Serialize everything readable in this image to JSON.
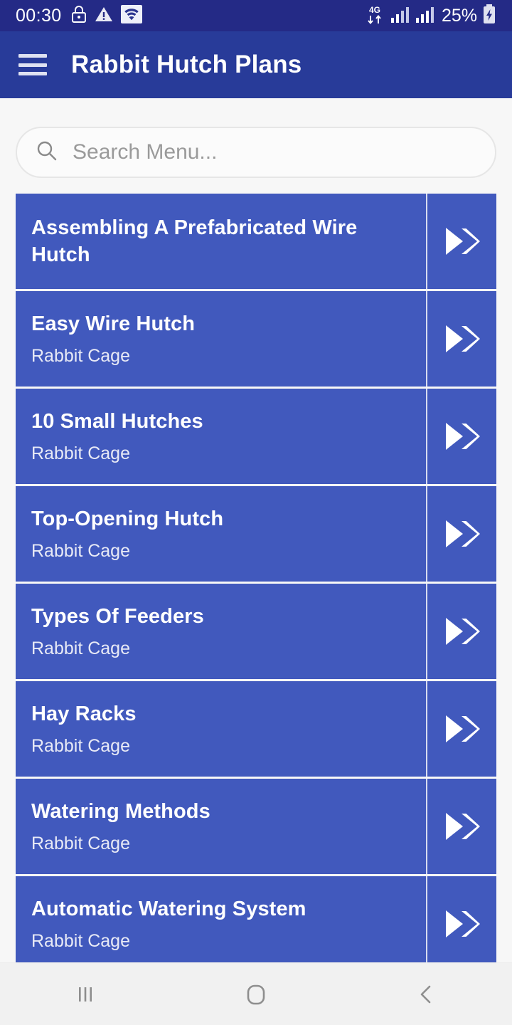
{
  "status_bar": {
    "time": "00:30",
    "battery_percent": "25%",
    "network": "4G",
    "icons": [
      "lock-icon",
      "warning-icon",
      "wifi-icon",
      "mobile-data-icon",
      "signal-bars-icon",
      "signal-bars-icon",
      "battery-charging-icon"
    ],
    "background_color": "#242a86"
  },
  "app_bar": {
    "menu_icon": "hamburger-menu-icon",
    "title": "Rabbit Hutch Plans",
    "background_color": "#283b99"
  },
  "search": {
    "icon": "search-icon",
    "placeholder": "Search Menu...",
    "value": ""
  },
  "list": {
    "accent_color": "#4159bd",
    "arrow_icon": "double-chevron-right-icon",
    "items": [
      {
        "title": "Assembling A Prefabricated Wire Hutch",
        "subtitle": ""
      },
      {
        "title": "Easy Wire Hutch",
        "subtitle": "Rabbit Cage"
      },
      {
        "title": "10 Small Hutches",
        "subtitle": "Rabbit Cage"
      },
      {
        "title": "Top-Opening Hutch",
        "subtitle": "Rabbit Cage"
      },
      {
        "title": "Types Of Feeders",
        "subtitle": "Rabbit Cage"
      },
      {
        "title": "Hay Racks",
        "subtitle": "Rabbit Cage"
      },
      {
        "title": "Watering Methods",
        "subtitle": "Rabbit Cage"
      },
      {
        "title": "Automatic Watering System",
        "subtitle": "Rabbit Cage"
      }
    ]
  },
  "nav_bar": {
    "recents_icon": "recents-icon",
    "home_icon": "home-icon",
    "back_icon": "back-icon",
    "background_color": "#f1f1f1"
  }
}
